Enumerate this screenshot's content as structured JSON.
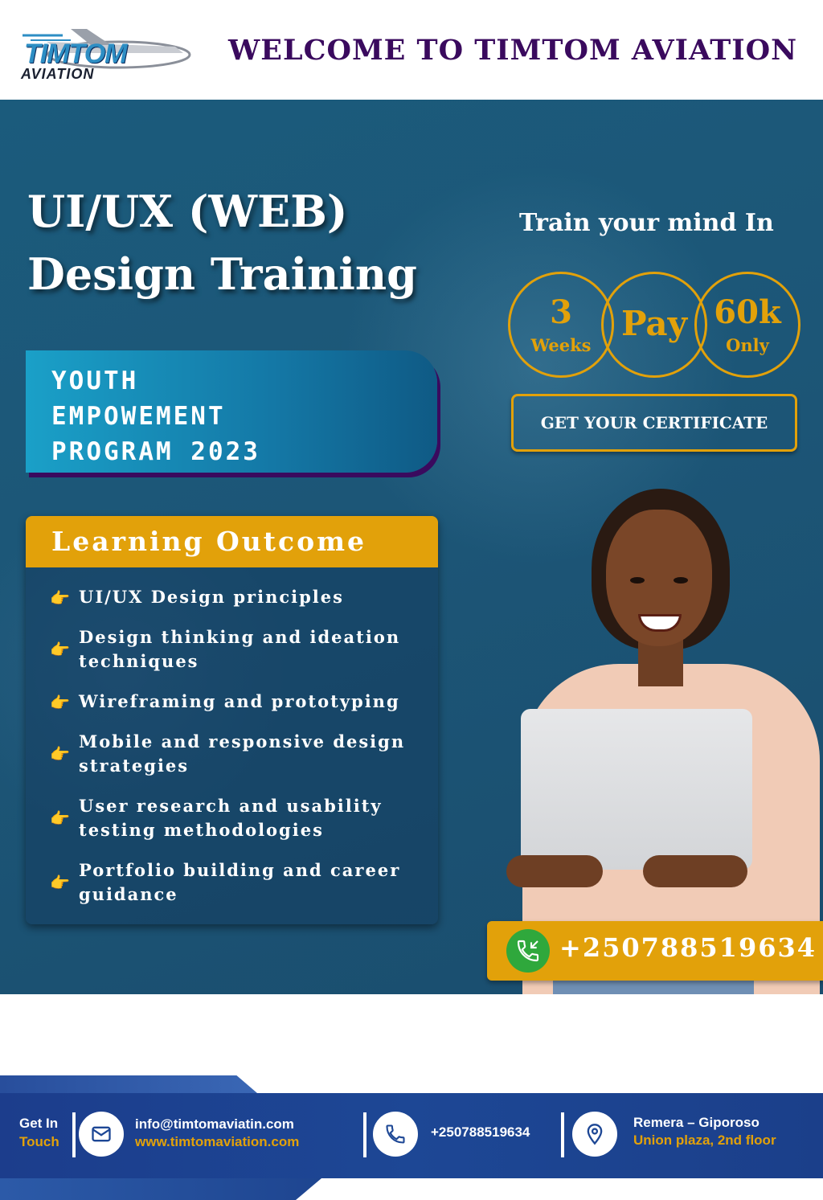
{
  "header": {
    "logo_line1": "TIMTOM",
    "logo_line2": "AVIATION",
    "welcome": "WELCOME TO TIMTOM AVIATION"
  },
  "hero": {
    "title_line1": "UI/UX (WEB)",
    "title_line2": "Design Training",
    "tagline": "Train your mind In",
    "badges": [
      {
        "big": "3",
        "small": "Weeks"
      },
      {
        "big": "Pay",
        "small": ""
      },
      {
        "big": "60k",
        "small": "Only"
      }
    ],
    "cert_button": "GET YOUR CERTIFICATE",
    "program_lines": [
      "YOUTH",
      "EMPOWEMENT",
      "PROGRAM 2023"
    ],
    "learning_outcome": {
      "heading": "Learning Outcome",
      "items": [
        "UI/UX Design principles",
        "Design thinking and ideation techniques",
        "Wireframing and prototyping",
        "Mobile and responsive design strategies",
        "User research and usability testing methodologies",
        "Portfolio building and career guidance"
      ]
    },
    "phone": "+250788519634"
  },
  "footer": {
    "get_in": "Get In",
    "touch": "Touch",
    "email": "info@timtomaviatin.com",
    "website": "www.timtomaviation.com",
    "phone": "+250788519634",
    "address_line1": "Remera – Giporoso",
    "address_line2": "Union plaza, 2nd floor"
  },
  "icons": [
    "hand-pointer-icon",
    "phone-call-icon",
    "mail-icon",
    "location-pin-icon",
    "airplane-logo-icon"
  ],
  "colors": {
    "accent": "#e2a10a",
    "title_purple": "#3a0a5e",
    "hero_blue": "#1b5b7c",
    "footer_blue": "#1d4795",
    "phone_green": "#2fa83c"
  }
}
